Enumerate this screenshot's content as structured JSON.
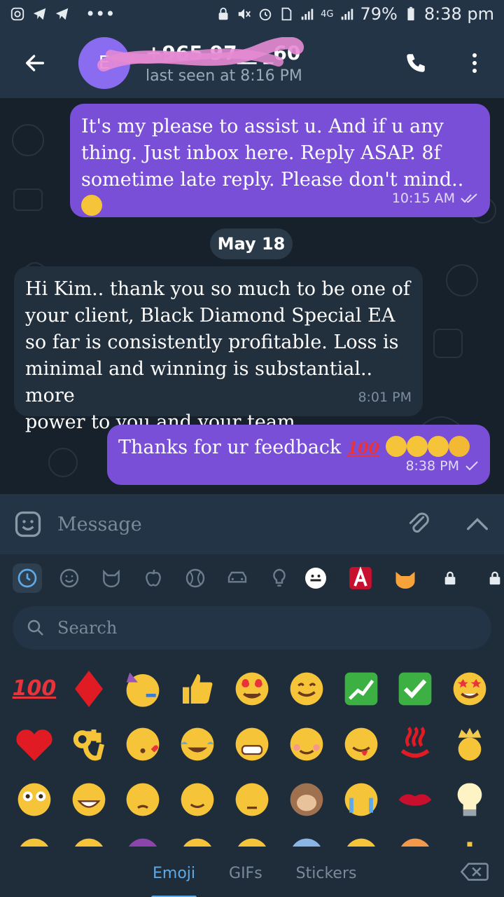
{
  "status_bar": {
    "battery": "79%",
    "time": "8:38 pm",
    "network": "4G"
  },
  "header": {
    "avatar_letter": "E",
    "contact_name": "+965 97__ _60",
    "contact_status": "last seen at 8:16 PM"
  },
  "messages": [
    {
      "direction": "outgoing",
      "text": "It's my please to assist u. And if u any\nthing. Just inbox here. Reply ASAP. 8f\nsometime late reply. Please don't mind..",
      "time": "10:15 AM",
      "ticks": "double"
    },
    {
      "direction": "incoming",
      "text": "Hi Kim.. thank you so much to be one of\nyour client, Black Diamond Special EA\nso far is consistently profitable. Loss is\nminimal and winning is substantial.. more\npower to you and your team...",
      "time": "8:01 PM"
    },
    {
      "direction": "outgoing",
      "text": "Thanks for ur feedback ",
      "time": "8:38 PM",
      "ticks": "single"
    }
  ],
  "date_divider": "May 18",
  "input": {
    "placeholder": "Message"
  },
  "emoji_panel": {
    "search_placeholder": "Search",
    "tabs": [
      "Emoji",
      "GIFs",
      "Stickers"
    ],
    "active_tab": "Emoji",
    "categories": [
      "recent-icon",
      "smiley-icon",
      "cat-icon",
      "apple-icon",
      "ball-icon",
      "car-icon",
      "bulb-icon",
      "emoji-pack-1",
      "emoji-pack-2",
      "emoji-pack-3",
      "locked-pack-1",
      "locked-pack-2"
    ],
    "inline_hundred": "100",
    "grid": [
      [
        "hundred",
        "diamond",
        "partying-face",
        "thumbs-up",
        "heart-eyes",
        "smile",
        "yen-chart",
        "check-box",
        "star-struck"
      ],
      [
        "red-heart",
        "ok-hand",
        "kiss-heart",
        "tears-of-joy",
        "grin",
        "blush",
        "wink-tongue",
        "hot-springs",
        "crown-man"
      ],
      [
        "flushed",
        "grin-big",
        "pensive",
        "wink",
        "unamused",
        "see-no-evil",
        "crying",
        "lips",
        "bulb"
      ],
      [
        "row4-1",
        "row4-2",
        "row4-3",
        "row4-4",
        "row4-5",
        "row4-6",
        "row4-7",
        "row4-8",
        "row4-9"
      ]
    ]
  },
  "colors": {
    "outgoing_bubble": "#7a4fd8",
    "incoming_bubble": "#222f3d",
    "header": "#243447",
    "accent": "#5ea9e6"
  }
}
